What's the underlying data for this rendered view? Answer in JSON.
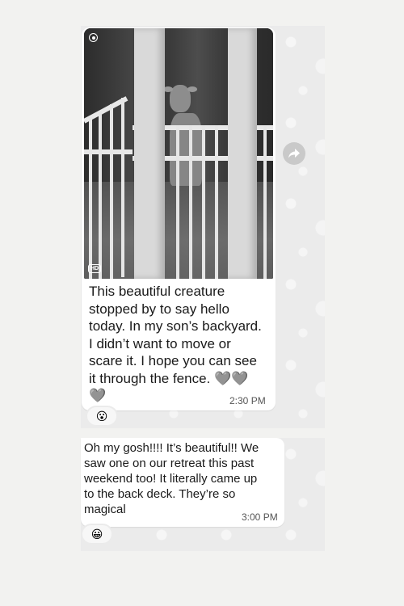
{
  "messages": [
    {
      "text": "This beautiful creature\nstopped by to say hello\ntoday. In my son’s backyard.\nI didn’t want to move or\nscare it. I hope you can see\nit through the fence. 🩶🩶\n🩶",
      "time": "2:30 PM",
      "reaction": "😮",
      "media": {
        "badge": "HD"
      }
    },
    {
      "text": "Oh my gosh!!!! It’s beautiful!! We\nsaw one on our retreat this past\nweekend too! It literally came up\nto the back deck. They’re so\nmagical",
      "time": "3:00 PM",
      "reaction": "😀"
    }
  ],
  "icons": {
    "share": "forward-arrow-icon",
    "view_once": "circle-dot-icon"
  }
}
